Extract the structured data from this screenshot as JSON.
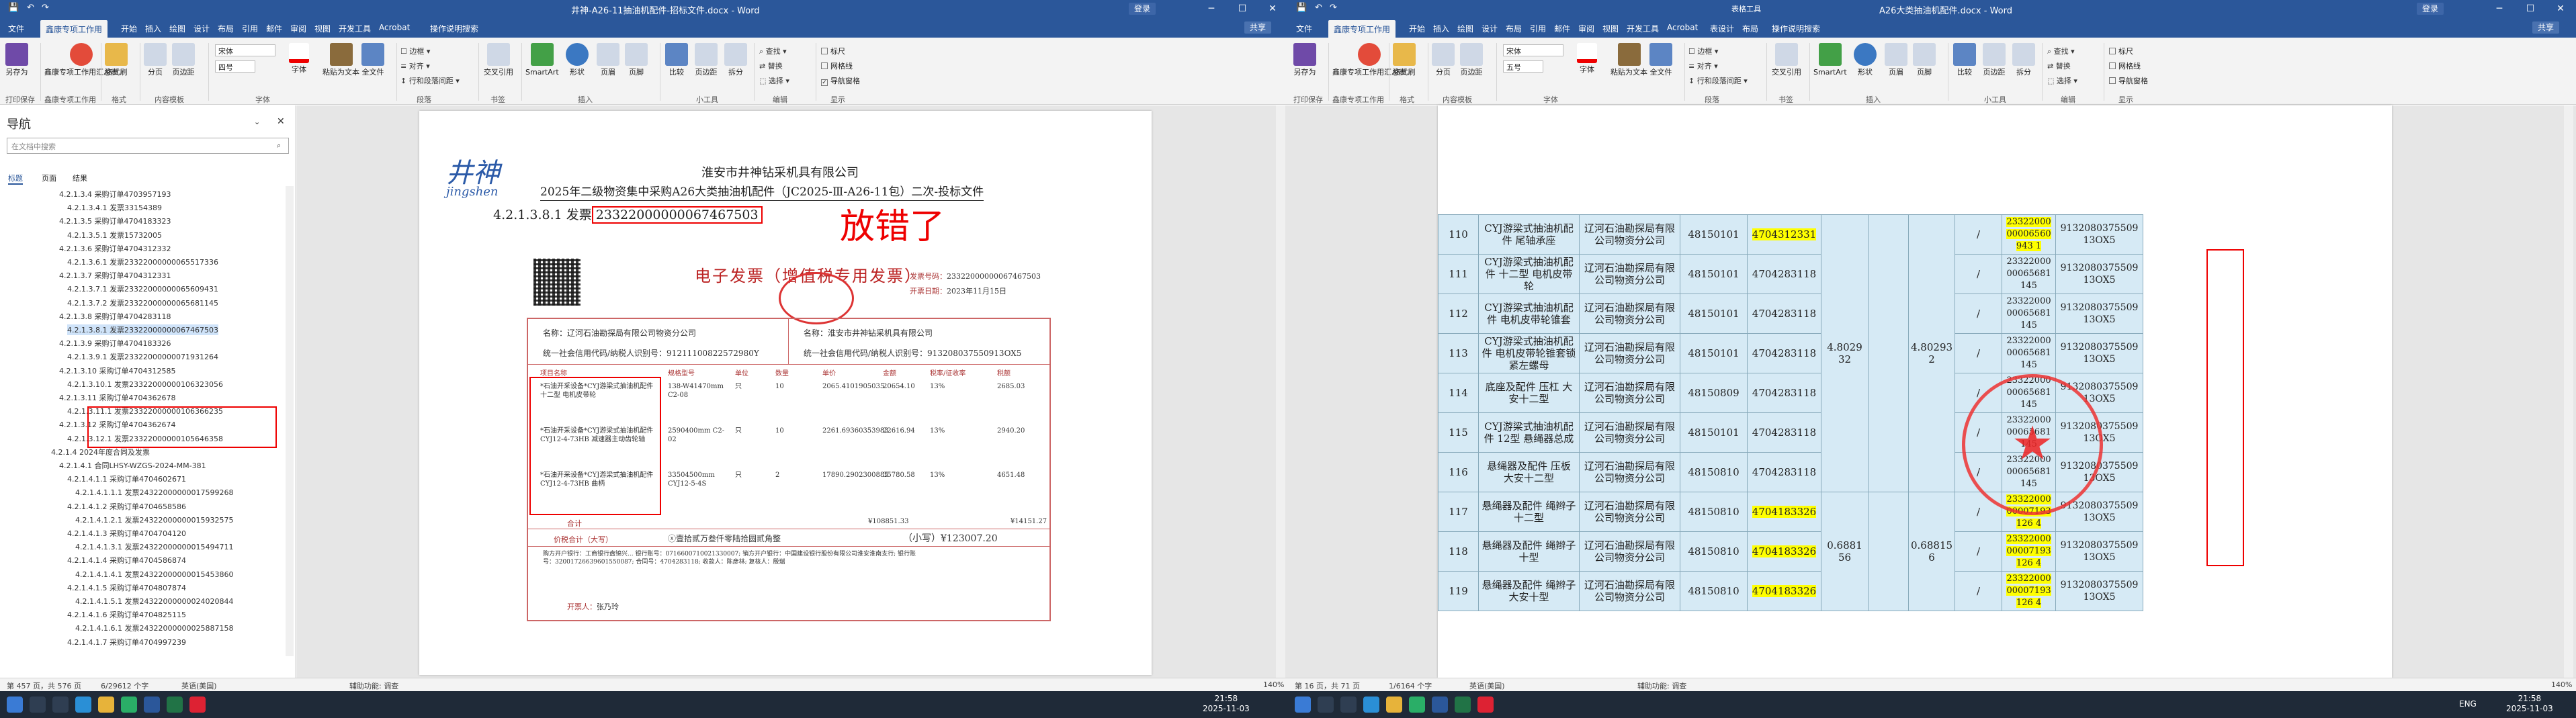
{
  "left": {
    "title": "井神-A26-11抽油机配件-招标文件.docx - Word",
    "login": "登录",
    "share": "共享",
    "tabs": [
      "文件",
      "鑫康专项工作用",
      "开始",
      "插入",
      "绘图",
      "设计",
      "布局",
      "引用",
      "邮件",
      "审阅",
      "视图",
      "开发工具",
      "Acrobat",
      "操作说明搜索"
    ],
    "ribbon": {
      "buttons": [
        "另存为",
        "鑫康专项工作用汇总表",
        "格式刷",
        "分页",
        "页边距",
        "页码",
        "复制",
        "粘贴为文本",
        "全文件",
        "图片",
        "形状",
        "页眉",
        "页脚",
        "交叉引用",
        "SmartArt",
        "页码",
        "比较",
        "页边距",
        "拆分"
      ],
      "font": "宋体",
      "size": "四号",
      "groups": [
        "打印保存",
        "鑫康专项工作用",
        "格式",
        "内容模板",
        "字体",
        "段落",
        "书签",
        "插入",
        "页眉页脚",
        "小工具",
        "编辑",
        "显示"
      ],
      "checks": [
        "标尺",
        "网格线",
        "导航窗格"
      ]
    },
    "nav": {
      "heading": "导航",
      "search_placeholder": "在文档中搜索",
      "tabs": [
        "标题",
        "页面",
        "结果"
      ],
      "items": [
        "4.2.1.3.4 采购订单4703957193",
        "4.2.1.3.4.1 发票33154389",
        "4.2.1.3.5 采购订单4704183323",
        "4.2.1.3.5.1 发票15732005",
        "4.2.1.3.6 采购订单4704312332",
        "4.2.1.3.6.1 发票23322000000065517336",
        "4.2.1.3.7 采购订单4704312331",
        "4.2.1.3.7.1 发票23322000000065609431",
        "4.2.1.3.7.2 发票23322000000065681145",
        "4.2.1.3.8 采购订单4704283118",
        "4.2.1.3.8.1 发票23322000000067467503",
        "4.2.1.3.9 采购订单4704183326",
        "4.2.1.3.9.1 发票23322000000071931264",
        "4.2.1.3.10 采购订单4704312585",
        "4.2.1.3.10.1 发票23322000000106323056",
        "4.2.1.3.11 采购订单4704362678",
        "4.2.1.3.11.1 发票23322000000106366235",
        "4.2.1.3.12 采购订单4704362674",
        "4.2.1.3.12.1 发票23322000000105646358",
        "4.2.1.4 2024年度合同及发票",
        "4.2.1.4.1 合同LHSY-WZGS-2024-MM-381",
        "4.2.1.4.1.1 采购订单4704602671",
        "4.2.1.4.1.1.1 发票24322000000017599268",
        "4.2.1.4.1.2 采购订单4704658586",
        "4.2.1.4.1.2.1 发票24322000000015932575",
        "4.2.1.4.1.3 采购订单4704704120",
        "4.2.1.4.1.3.1 发票24322000000015494711",
        "4.2.1.4.1.4 采购订单4704586874",
        "4.2.1.4.1.4.1 发票24322000000015453860",
        "4.2.1.4.1.5 采购订单4704807874",
        "4.2.1.4.1.5.1 发票24322000000024020844",
        "4.2.1.4.1.6 采购订单4704825115",
        "4.2.1.4.1.6.1 发票24322000000025887158",
        "4.2.1.4.1.7 采购订单4704997239"
      ],
      "selected_index": 10
    },
    "doc": {
      "logo": "井神",
      "logo_sub": "jingshen",
      "company": "淮安市井神钻采机具有限公司",
      "project": "2025年二级物资集中采购A26大类抽油机配件（JC2025-Ⅲ-A26-11包）二次-投标文件",
      "heading_prefix": "4.2.1.3.8.1 发票",
      "heading_number": "23322000000067467503",
      "annotation": "放错了",
      "invoice": {
        "title": "电子发票（增值税专用发票）",
        "no_label": "发票号码：",
        "no": "23322000000067467503",
        "date_label": "开票日期：",
        "date": "2023年11月15日",
        "buyer_name": "名称：辽河石油勘探局有限公司物资分公司",
        "buyer_tax": "统一社会信用代码/纳税人识别号：91211100822572980Y",
        "seller_name": "名称：淮安市井神钻采机具有限公司",
        "seller_tax": "统一社会信用代码/纳税人识别号：913208037550913OX5",
        "col_headers": [
          "项目名称",
          "规格型号",
          "单位",
          "数量",
          "单价",
          "金额",
          "税率/征收率",
          "税额"
        ],
        "rows": [
          {
            "name": "*石油开采设备*CYJ游梁式抽油机配件 十二型 电机皮带轮",
            "spec": "138-W41470mm C2-08",
            "unit": "只",
            "qty": "10",
            "price": "2065.4101905035",
            "amount": "20654.10",
            "rate": "13%",
            "tax": "2685.03"
          },
          {
            "name": "*石油开采设备*CYJ游梁式抽油机配件 CYJ12-4-73HB 减速器主动齿轮轴",
            "spec": "2590400mm C2-02",
            "unit": "只",
            "qty": "10",
            "price": "2261.69360353983",
            "amount": "22616.94",
            "rate": "13%",
            "tax": "2940.20"
          },
          {
            "name": "*石油开采设备*CYJ游梁式抽油机配件 CYJ12-4-73HB 曲柄",
            "spec": "33504500mm CYJ12-5-4S",
            "unit": "只",
            "qty": "2",
            "price": "17890.2902300885",
            "amount": "35780.58",
            "rate": "13%",
            "tax": "4651.48"
          }
        ],
        "total_label": "合计",
        "total_amount": "¥108851.33",
        "total_tax": "¥14151.27",
        "grand_label": "价税合计（大写）",
        "grand_words": "ⓧ壹拾贰万叁仟零陆拾圆贰角整",
        "grand_small": "（小写）¥123007.20",
        "remarks": "购方开户银行：工商银行盘锦兴... 银行账号：0716600710021330007; 销方开户银行：中国建设银行股份有限公司淮安淮南支行; 银行账号：32001726639601550087; 合同号：4704283118; 收款人：陈彦林; 复核人：殷瑞",
        "issuer_label": "开票人：",
        "issuer": "张乃玲"
      }
    },
    "status": {
      "page": "第 457 页，共 576 页",
      "words": "6/29612 个字",
      "lang": "英语(美国)",
      "accessibility": "辅助功能: 调查",
      "zoom": "140%"
    }
  },
  "right": {
    "title": "A26大类抽油机配件.docx - Word",
    "context": "表格工具",
    "login": "登录",
    "share": "共享",
    "tabs": [
      "文件",
      "鑫康专项工作用",
      "开始",
      "插入",
      "绘图",
      "设计",
      "布局",
      "引用",
      "邮件",
      "审阅",
      "视图",
      "开发工具",
      "Acrobat",
      "表设计",
      "布局",
      "操作说明搜索"
    ],
    "table": {
      "rows": [
        {
          "no": "110",
          "name": "CYJ游梁式抽油机配件 尾轴承座",
          "buyer": "辽河石油勘探局有限公司物资分公司",
          "code": "48150101",
          "order": "4704312331",
          "order_hl": true,
          "inv": "2332200000006560943 1",
          "inv_hl": true,
          "tax": "913208037550913OX5"
        },
        {
          "no": "111",
          "name": "CYJ游梁式抽油机配件 十二型 电机皮带轮",
          "buyer": "辽河石油勘探局有限公司物资分公司",
          "code": "48150101",
          "order": "4704283118",
          "order_hl": false,
          "inv": "2332200000065681145",
          "inv_hl": false,
          "tax": "913208037550913OX5"
        },
        {
          "no": "112",
          "name": "CYJ游梁式抽油机配件 电机皮带轮锥套",
          "buyer": "辽河石油勘探局有限公司物资分公司",
          "code": "48150101",
          "order": "4704283118",
          "order_hl": false,
          "inv": "2332200000065681145",
          "inv_hl": false,
          "tax": "913208037550913OX5"
        },
        {
          "no": "113",
          "name": "CYJ游梁式抽油机配件 电机皮带轮锥套锁紧左螺母",
          "buyer": "辽河石油勘探局有限公司物资分公司",
          "code": "48150101",
          "order": "4704283118",
          "order_hl": false,
          "inv": "2332200000065681145",
          "inv_hl": false,
          "tax": "913208037550913OX5"
        },
        {
          "no": "114",
          "name": "底座及配件 压杠 大安十二型",
          "buyer": "辽河石油勘探局有限公司物资分公司",
          "code": "48150809",
          "order": "4704283118",
          "order_hl": false,
          "inv": "2332200000065681145",
          "inv_hl": false,
          "tax": "913208037550913OX5"
        },
        {
          "no": "115",
          "name": "CYJ游梁式抽油机配件 12型 悬绳器总成",
          "buyer": "辽河石油勘探局有限公司物资分公司",
          "code": "48150101",
          "order": "4704283118",
          "order_hl": false,
          "inv": "2332200000065681145",
          "inv_hl": false,
          "tax": "913208037550913OX5"
        },
        {
          "no": "116",
          "name": "悬绳器及配件 压板 大安十二型",
          "buyer": "辽河石油勘探局有限公司物资分公司",
          "code": "48150810",
          "order": "4704283118",
          "order_hl": false,
          "inv": "2332200000065681145",
          "inv_hl": false,
          "tax": "913208037550913OX5"
        },
        {
          "no": "117",
          "name": "悬绳器及配件 绳辫子 十二型",
          "buyer": "辽河石油勘探局有限公司物资分公司",
          "code": "48150810",
          "order": "4704183326",
          "order_hl": true,
          "inv": "2332200000007193126 4",
          "inv_hl": true,
          "tax": "913208037550913OX5"
        },
        {
          "no": "118",
          "name": "悬绳器及配件 绳辫子 十型",
          "buyer": "辽河石油勘探局有限公司物资分公司",
          "code": "48150810",
          "order": "4704183326",
          "order_hl": true,
          "inv": "2332200000007193126 4",
          "inv_hl": true,
          "tax": "913208037550913OX5"
        },
        {
          "no": "119",
          "name": "悬绳器及配件 绳辫子 大安十型",
          "buyer": "辽河石油勘探局有限公司物资分公司",
          "code": "48150810",
          "order": "4704183326",
          "order_hl": true,
          "inv": "2332200000007193126 4",
          "inv_hl": true,
          "tax": "913208037550913OX5"
        }
      ],
      "merged_a": [
        "4.8029 32",
        "0.6881 56"
      ],
      "merged_b": [
        "4.80293 2",
        "0.68815 6"
      ],
      "slash": "/"
    },
    "status": {
      "page": "第 16 页，共 71 页",
      "words": "1/6164 个字",
      "lang": "英语(美国)",
      "accessibility": "辅助功能: 调查",
      "zoom": "140%"
    }
  },
  "taskbar": {
    "left_time": "21:58",
    "left_date": "2025-11-03",
    "right_time": "21:58",
    "right_date": "2025-11-03",
    "tray": "ENG"
  }
}
